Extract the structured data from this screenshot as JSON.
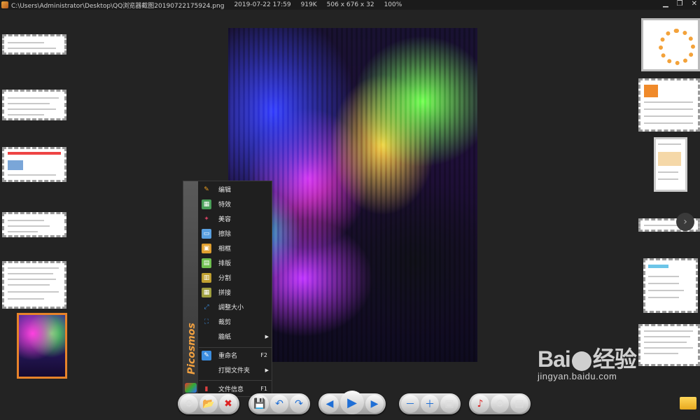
{
  "titlebar": {
    "path": "C:\\Users\\Administrator\\Desktop\\QQ浏览器截图20190722175924.png",
    "datetime": "2019-07-22 17:59",
    "filesize": "919K",
    "dimensions": "506 x 676 x 32",
    "zoom": "100%",
    "minimize_glyph": "▁",
    "restore_glyph": "❐",
    "close_glyph": "✕"
  },
  "context_menu": {
    "brand": "Picosmos",
    "items": [
      {
        "label": "编辑",
        "icon": "pencil-icon",
        "color": "#f0a020",
        "glyph": "✎"
      },
      {
        "label": "特效",
        "icon": "effects-icon",
        "color": "#4aa05a",
        "glyph": "▦"
      },
      {
        "label": "美容",
        "icon": "beauty-icon",
        "color": "#d04060",
        "glyph": "✦"
      },
      {
        "label": "擦除",
        "icon": "eraser-icon",
        "color": "#5aa0e0",
        "glyph": "▭"
      },
      {
        "label": "相框",
        "icon": "frame-icon",
        "color": "#e0a030",
        "glyph": "▣"
      },
      {
        "label": "排版",
        "icon": "layout-icon",
        "color": "#70c050",
        "glyph": "▤"
      },
      {
        "label": "分割",
        "icon": "split-icon",
        "color": "#c0a030",
        "glyph": "▥"
      },
      {
        "label": "拼接",
        "icon": "collage-icon",
        "color": "#a0a040",
        "glyph": "▦"
      },
      {
        "label": "調整大小",
        "icon": "resize-icon",
        "color": "#3b8de0",
        "glyph": "⤢"
      },
      {
        "label": "裁剪",
        "icon": "crop-icon",
        "color": "#3b8de0",
        "glyph": "⛶"
      },
      {
        "label": "牆紙",
        "icon": "wallpaper-icon",
        "color": "",
        "glyph": "",
        "submenu": "▶"
      },
      {
        "label": "重命名",
        "icon": "rename-icon",
        "color": "#3b8de0",
        "glyph": "✎",
        "shortcut": "F2"
      },
      {
        "label": "打開文件夹",
        "icon": "folder-icon",
        "color": "",
        "glyph": "",
        "submenu": "▶"
      },
      {
        "label": "文件信息",
        "icon": "file-info-icon",
        "color": "#e04040",
        "glyph": "▮",
        "shortcut": "F1"
      }
    ]
  },
  "toolbar": {
    "settings": "⚙",
    "open": "📂",
    "delete": "✖",
    "save": "💾",
    "undo": "↶",
    "redo": "↷",
    "prev": "◀",
    "play": "▶",
    "next": "▶",
    "zoom_out": "－",
    "zoom_in": "＋",
    "fit": "▣",
    "music": "♪",
    "options": "⚙",
    "filmstrip": "▤"
  },
  "watermark": {
    "main": "Bai",
    "main_tail": "经验",
    "sub": "jingyan.baidu.com"
  },
  "side_arrow": "›"
}
